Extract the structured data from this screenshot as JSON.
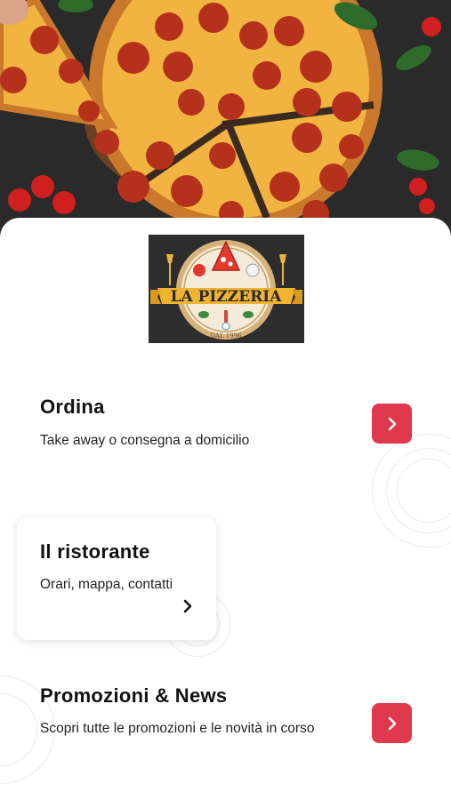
{
  "hero": {
    "image": "pepperoni-pizza-photo"
  },
  "logo": {
    "name": "LA PIZZERIA",
    "since": "DAL 1996"
  },
  "sections": [
    {
      "title": "Ordina",
      "subtitle": "Take away o consegna a domicilio",
      "icon": "chevron-right-icon"
    },
    {
      "title": "Il ristorante",
      "subtitle": "Orari, mappa, contatti",
      "icon": "chevron-right-icon"
    },
    {
      "title": "Promozioni & News",
      "subtitle": "Scopri tutte le promozioni e le novità in corso",
      "icon": "chevron-right-icon"
    }
  ],
  "colors": {
    "accent": "#e0394d",
    "background": "#ffffff",
    "text": "#111111"
  }
}
